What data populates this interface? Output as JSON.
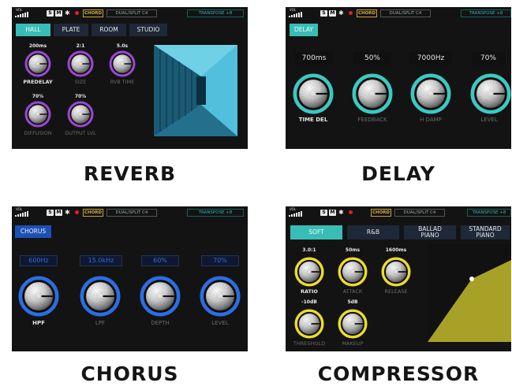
{
  "status": {
    "vol_label": "VOL",
    "s_chip": "S",
    "m_chip": "M",
    "bluetooth_glyph": "✱",
    "chord": "CHORD",
    "split": "DUAL/SPLIT C4",
    "transpose": "TRANSPOSE +8"
  },
  "colors": {
    "teal": "#3cc9c1",
    "purple": "#9a47d4",
    "blue": "#2a6ee3",
    "yellow": "#ecdc2a",
    "olive": "#a7a227"
  },
  "reverb": {
    "caption": "REVERB",
    "tabs": [
      "HALL",
      "PLATE",
      "ROOM",
      "STUDIO"
    ],
    "knobs": [
      {
        "value": "200ms",
        "label": "PREDELAY"
      },
      {
        "value": "2:1",
        "label": "SIZE"
      },
      {
        "value": "5.0s",
        "label": "RVB TIME"
      },
      {
        "value": "70%",
        "label": "DIFFUSION"
      },
      {
        "value": "70%",
        "label": "OUTPUT LVL"
      }
    ]
  },
  "delay": {
    "caption": "DELAY",
    "tabs": [
      "DELAY"
    ],
    "knobs": [
      {
        "value": "700ms",
        "label": "TIME DEL"
      },
      {
        "value": "50%",
        "label": "FEEDBACK"
      },
      {
        "value": "7000Hz",
        "label": "H DAMP"
      },
      {
        "value": "70%",
        "label": "LEVEL"
      }
    ]
  },
  "chorus": {
    "caption": "CHORUS",
    "tabs": [
      "CHORUS"
    ],
    "knobs": [
      {
        "value": "600Hz",
        "label": "HPF"
      },
      {
        "value": "15.0kHz",
        "label": "LPF"
      },
      {
        "value": "60%",
        "label": "DEPTH"
      },
      {
        "value": "70%",
        "label": "LEVEL"
      }
    ]
  },
  "compressor": {
    "caption": "COMPRESSOR",
    "tabs": [
      "SOFT",
      "R&B",
      "BALLAD\nPIANO",
      "STANDARD\nPIANO"
    ],
    "knobs": [
      {
        "value": "3.0:1",
        "label": "RATIO"
      },
      {
        "value": "50ms",
        "label": "ATTACK"
      },
      {
        "value": "1600ms",
        "label": "RELEASE"
      },
      {
        "value": "-10dB",
        "label": "THRESHOLD"
      },
      {
        "value": "5dB",
        "label": "MAKEUP"
      }
    ]
  }
}
